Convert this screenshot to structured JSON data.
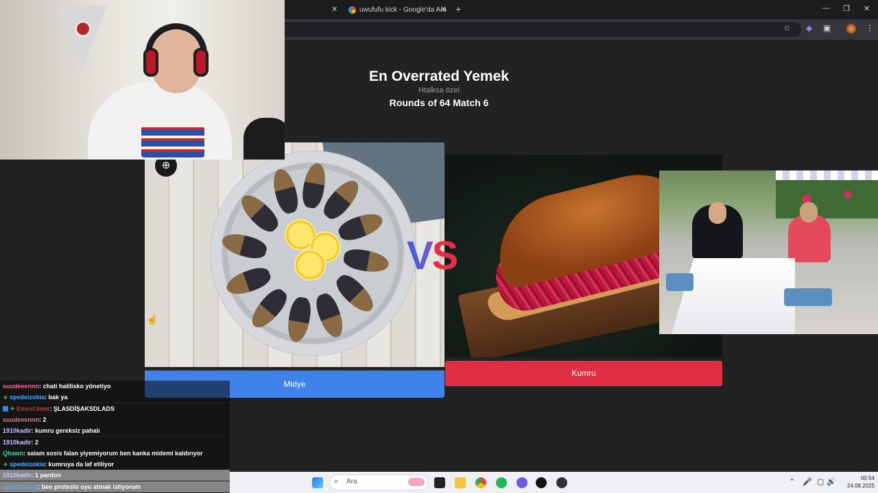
{
  "browser": {
    "tabs": [
      {
        "label": ""
      },
      {
        "label": "uwufufu kick - Google'da Ara"
      }
    ],
    "close_glyph": "✕",
    "new_tab_glyph": "+",
    "window_controls": [
      "—",
      "❐",
      "✕"
    ],
    "toolbar_icons": [
      "star-icon",
      "extension-icon",
      "puzzle-icon",
      "menu-icon"
    ]
  },
  "page": {
    "title": "En Overrated Yemek",
    "subtitle": "Htalksa özel",
    "round": "Rounds of 64 Match 6",
    "vs_label": "VS"
  },
  "left_option": {
    "label": "Midye",
    "color": "#3f82ea"
  },
  "right_option": {
    "label": "Kumru",
    "color": "#e02f45"
  },
  "chat": [
    {
      "user": "suudeeennn",
      "user_color": "#f06a9a",
      "badges": [],
      "message": "chati halilisko yönetiyo"
    },
    {
      "user": "spedeizokia",
      "user_color": "#4aa8ff",
      "badges": [
        "star"
      ],
      "message": "bak ya"
    },
    {
      "user": "Emesl.imor",
      "user_color": "#e03030",
      "badges": [
        "sq",
        "star"
      ],
      "message": "ŞLASDİŞAKSDLADS"
    },
    {
      "user": "suudeeennn",
      "user_color": "#f06a9a",
      "badges": [],
      "message": "2"
    },
    {
      "user": "1910kadir",
      "user_color": "#c8c8ff",
      "badges": [],
      "message": "kumru gereksiz pahalı"
    },
    {
      "user": "1910kadir",
      "user_color": "#c8c8ff",
      "badges": [],
      "message": "2"
    },
    {
      "user": "Qhawn",
      "user_color": "#3ad6a0",
      "badges": [],
      "message": "salam sosis falan yiyemiyorum ben kanka midemi kaldırıyor"
    },
    {
      "user": "spedeizokia",
      "user_color": "#4aa8ff",
      "badges": [
        "star"
      ],
      "message": "kumruya da laf etiliyor"
    },
    {
      "user": "1910kadir",
      "user_color": "#c8c8ff",
      "badges": [],
      "message": "1 pardon"
    },
    {
      "user": "spedeizokia",
      "user_color": "#4aa8ff",
      "badges": [],
      "message": "ben protesto oyu atmak istiyorum"
    }
  ],
  "chat_separator": ": ",
  "taskbar": {
    "search_placeholder": "Ara",
    "search_glyph": "⌕",
    "tray_glyphs": [
      "⌃",
      "🎤",
      "▢",
      "🔊"
    ],
    "time": "00:54",
    "date": "24.08.2025"
  }
}
